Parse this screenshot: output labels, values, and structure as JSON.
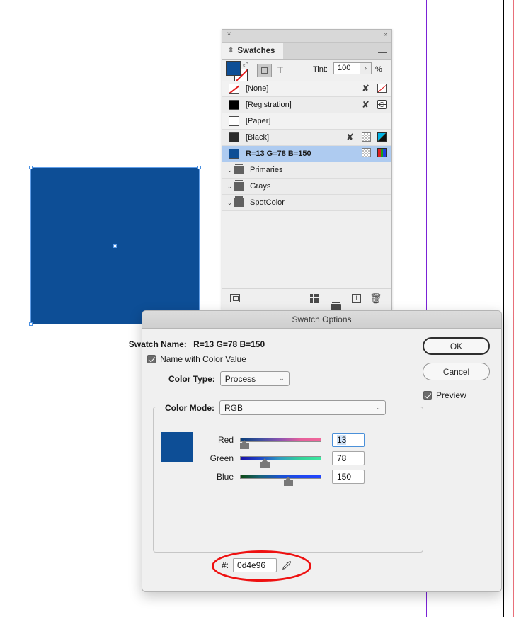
{
  "document": {
    "artwork": {
      "name": "blue-rectangle",
      "fill_hex": "#0d4e96"
    },
    "guides": {
      "purple_guide_color": "#7b22d6",
      "page_edge_color": "#000000",
      "bleed_guide_color": "#e8707a"
    }
  },
  "swatches_panel": {
    "close_icon": "×",
    "collapse_icon": "«",
    "tab_label": "Swatches",
    "tab_grip_icon": "⇕",
    "menu_icon": "hamburger-menu",
    "fill_color": "#0d4e96",
    "stroke_color": "none",
    "swap_icon": "⤢",
    "tint": {
      "label": "Tint:",
      "value": "100",
      "stepper_icon": "›",
      "unit": "%"
    },
    "rows": [
      {
        "name": "[None]",
        "chip": "none",
        "bold": false,
        "selected": false,
        "icons": [
          "nib-crossed",
          "none-slash"
        ]
      },
      {
        "name": "[Registration]",
        "chip": "#000000",
        "bold": false,
        "selected": false,
        "icons": [
          "nib-crossed",
          "registration"
        ]
      },
      {
        "name": "[Paper]",
        "chip": "#ffffff",
        "bold": false,
        "selected": false,
        "icons": []
      },
      {
        "name": "[Black]",
        "chip": "#2b2b2b",
        "bold": false,
        "selected": false,
        "icons": [
          "nib-crossed",
          "tint-tile",
          "cmyk"
        ]
      },
      {
        "name": "R=13 G=78 B=150",
        "chip": "#0d4e96",
        "bold": true,
        "selected": true,
        "icons": [
          "tint-tile",
          "rgb"
        ]
      }
    ],
    "groups": [
      {
        "name": "Primaries",
        "expand_icon": "⌄"
      },
      {
        "name": "Grays",
        "expand_icon": "⌄"
      },
      {
        "name": "SpotColor",
        "expand_icon": "⌄"
      }
    ],
    "bottom_bar": {
      "show_swatch_group_icon": "show-swatch-group",
      "new_color_group_icon": "new-color-group",
      "folder_icon": "new-group-folder",
      "new_swatch_icon": "+",
      "delete_icon": "🗑"
    }
  },
  "swatch_options_dialog": {
    "title": "Swatch Options",
    "swatch_name_label": "Swatch Name:",
    "swatch_name_value": "R=13 G=78 B=150",
    "name_with_color_value": {
      "label": "Name with Color Value",
      "checked": true
    },
    "color_type": {
      "label": "Color Type:",
      "value": "Process",
      "chevron": "⌄"
    },
    "color_mode": {
      "label": "Color Mode:",
      "value": "RGB",
      "chevron": "⌄"
    },
    "preview_color": "#0d4e96",
    "sliders": [
      {
        "label": "Red",
        "value": "13",
        "focused": true,
        "gradient": "linear-gradient(to right,#0b3f78,#3f4fa0,#8f53b0,#e5609b,#f0679a)"
      },
      {
        "label": "Green",
        "value": "78",
        "focused": false,
        "gradient": "linear-gradient(to right,#1a12a8,#1f48c8,#2f9fc0,#33d39a,#3ce8a0)"
      },
      {
        "label": "Blue",
        "value": "150",
        "focused": false,
        "gradient": "linear-gradient(to right,#0d4a12,#17637a,#1a52d0,#1f47f0,#2246ff)"
      }
    ],
    "hex": {
      "label": "#:",
      "value": "0d4e96",
      "eyedropper_icon": "eyedropper"
    },
    "buttons": {
      "ok": "OK",
      "cancel": "Cancel"
    },
    "preview_checkbox": {
      "label": "Preview",
      "checked": true
    }
  },
  "annotation": {
    "shape": "ellipse",
    "color": "#ee1111",
    "targets": "hex-field"
  }
}
